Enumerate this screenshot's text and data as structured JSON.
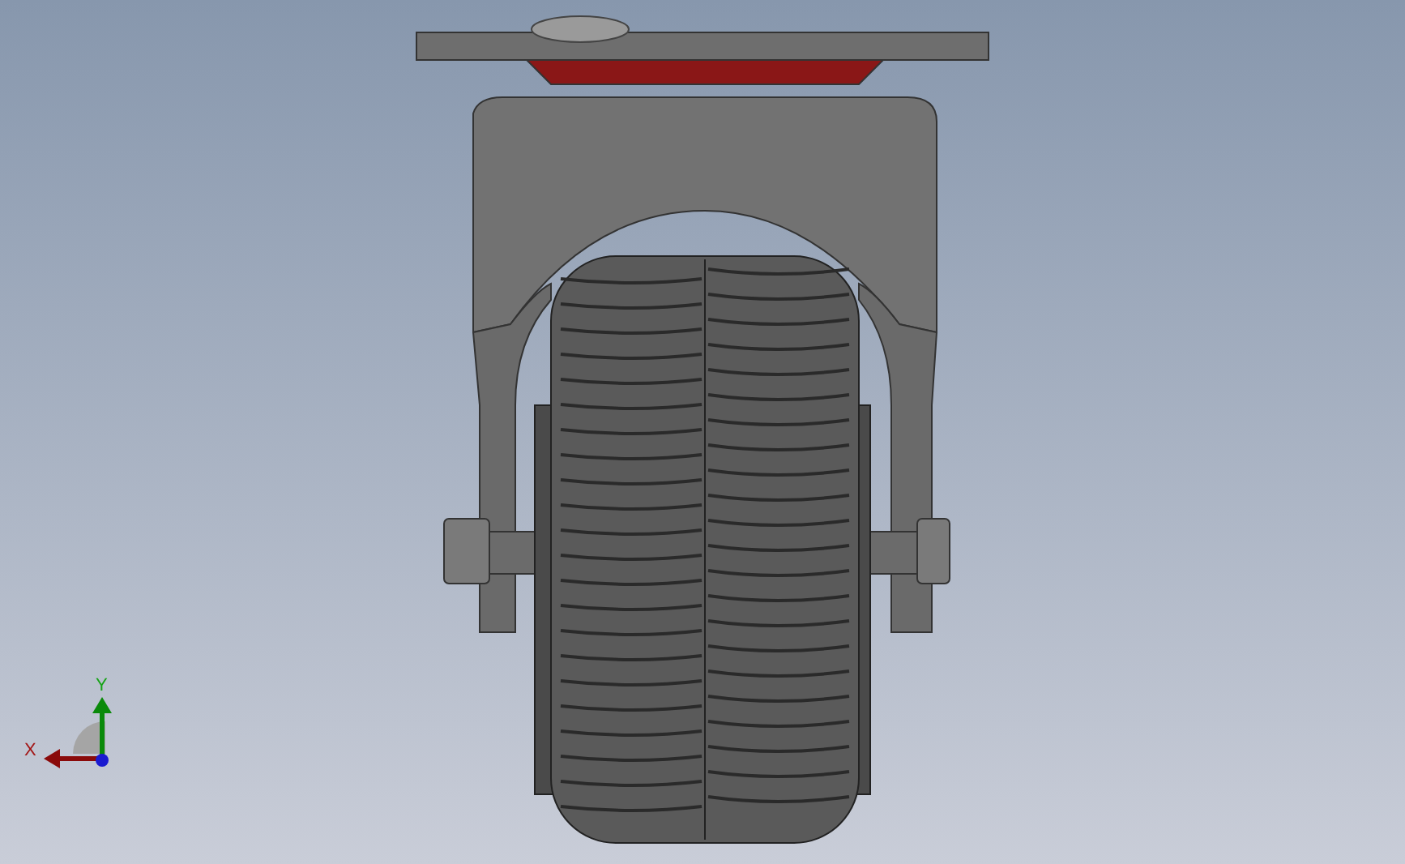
{
  "viewport": {
    "triad": {
      "axes": [
        {
          "kind": "y",
          "label": "Y"
        },
        {
          "kind": "x",
          "label": "X"
        }
      ]
    }
  }
}
